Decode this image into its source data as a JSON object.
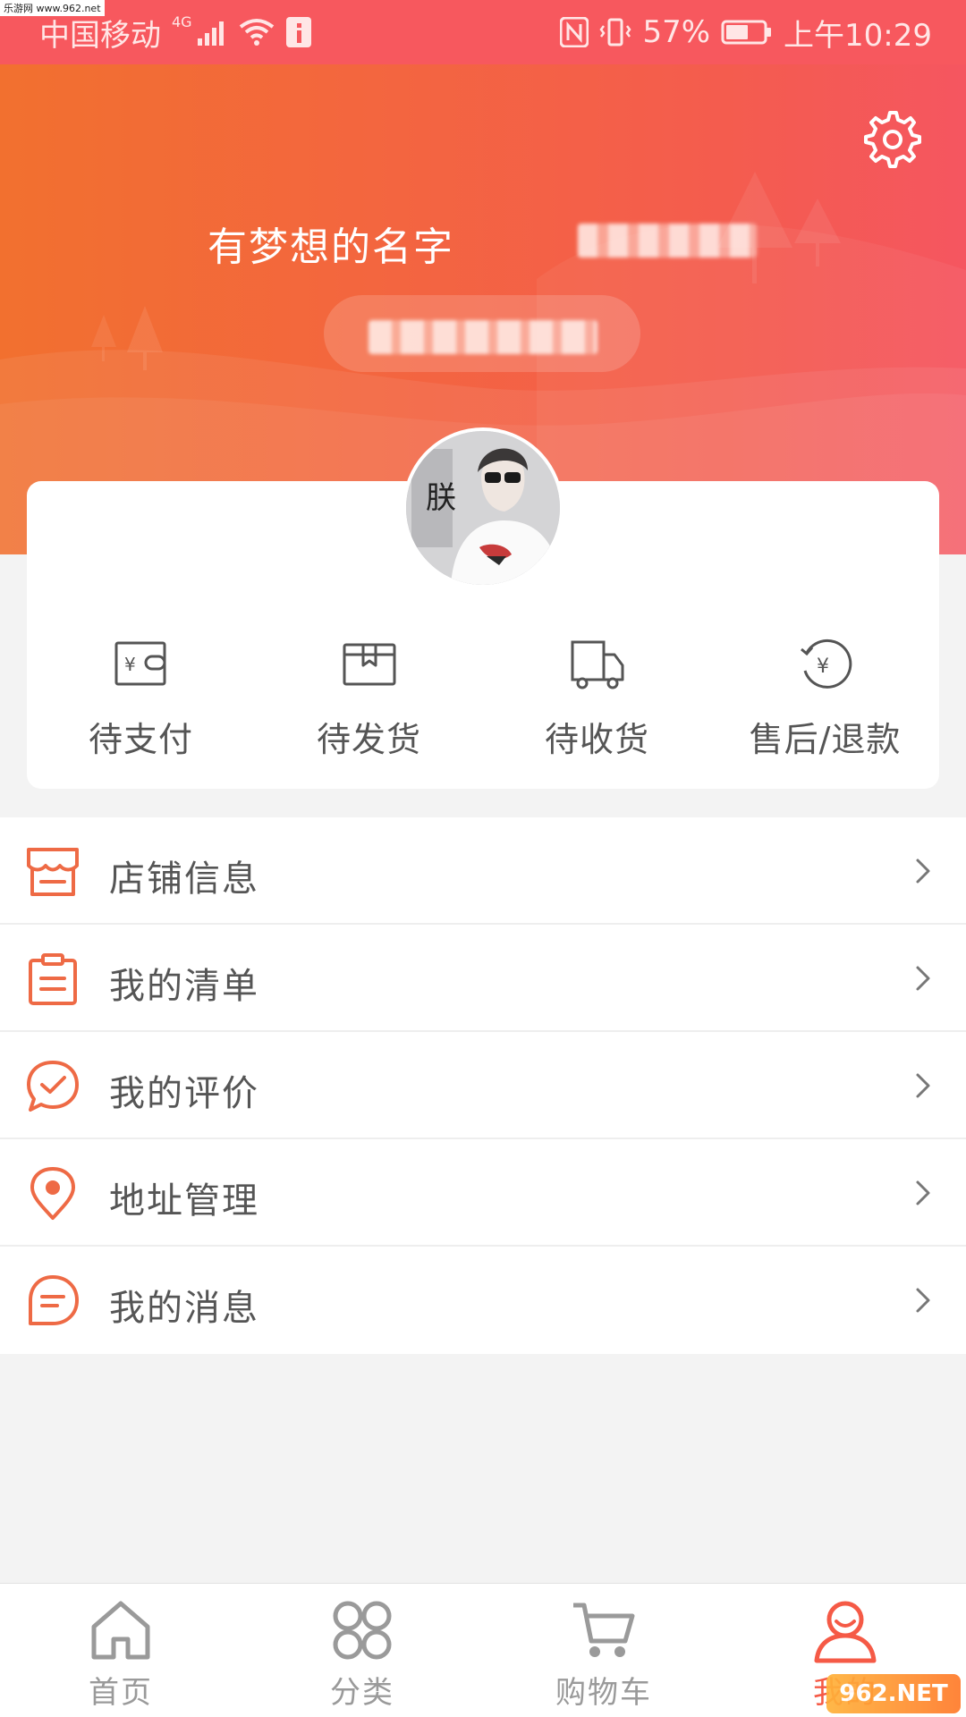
{
  "status_bar": {
    "carrier": "中国移动",
    "network": "4G",
    "battery": "57%",
    "time": "上午10:29",
    "source_watermark": "乐游网 www.962.net"
  },
  "header": {
    "user_name": "有梦想的名字",
    "settings_icon": "gear-icon"
  },
  "avatar": {
    "caption": "朕"
  },
  "orders": [
    {
      "label": "待支付",
      "icon": "wallet-icon"
    },
    {
      "label": "待发货",
      "icon": "box-icon"
    },
    {
      "label": "待收货",
      "icon": "truck-icon"
    },
    {
      "label": "售后/退款",
      "icon": "refund-icon"
    }
  ],
  "menu": [
    {
      "label": "店铺信息",
      "icon": "store-icon"
    },
    {
      "label": "我的清单",
      "icon": "clipboard-icon"
    },
    {
      "label": "我的评价",
      "icon": "comment-check-icon"
    },
    {
      "label": "地址管理",
      "icon": "location-pin-icon"
    },
    {
      "label": "我的消息",
      "icon": "message-icon"
    }
  ],
  "tabs": [
    {
      "label": "首页",
      "icon": "home-icon",
      "active": false
    },
    {
      "label": "分类",
      "icon": "category-icon",
      "active": false
    },
    {
      "label": "购物车",
      "icon": "cart-icon",
      "active": false
    },
    {
      "label": "我的",
      "icon": "user-icon",
      "active": true
    }
  ],
  "colors": {
    "brand": "#f45c4e",
    "accent_icon": "#ee6a45",
    "status_bar": "#f7585e",
    "tab_active": "#f55a46",
    "tab_inactive": "#9a9a9a"
  },
  "watermark": {
    "text": "962.NET",
    "subtext": "乐游网"
  }
}
